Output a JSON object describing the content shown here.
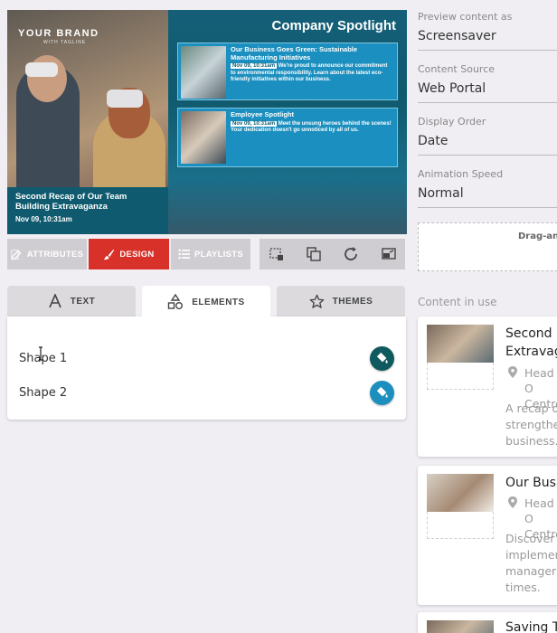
{
  "preview": {
    "brand": "YOUR BRAND",
    "brand_sub": "WITH TAGLINE",
    "feature": {
      "title": "Second Recap of Our Team Building Extravaganza",
      "date": "Nov 09, 10:31am"
    },
    "spotlight_title": "Company Spotlight",
    "cards": [
      {
        "title": "Our Business Goes Green: Sustainable Manufacturing Initiatives",
        "date": "Nov 09, 10:31am",
        "body": " We're proud to announce our commitment to environmental responsibility. Learn about the latest eco-friendly initiatives within our business."
      },
      {
        "title": "Employee Spotlight",
        "date": "Nov 09, 10:31am",
        "body": " Meet the unsung heroes behind the scenes! Your dedication doesn't go unnoticed by all of us."
      }
    ]
  },
  "toolbar": {
    "attributes": "ATTRIBUTES",
    "design": "DESIGN",
    "playlists": "PLAYLISTS",
    "icons": [
      "crop-icon",
      "copy-icon",
      "refresh-icon",
      "screen-swap-icon"
    ]
  },
  "tabs": {
    "text": "TEXT",
    "elements": "ELEMENTS",
    "themes": "THEMES"
  },
  "elements": [
    {
      "label": "Shape 1",
      "color": "#0f5a5e"
    },
    {
      "label": "Shape 2",
      "color": "#1d8fbe"
    }
  ],
  "settings": [
    {
      "label": "Preview content as",
      "value": "Screensaver"
    },
    {
      "label": "Content Source",
      "value": "Web Portal"
    },
    {
      "label": "Display Order",
      "value": "Date"
    },
    {
      "label": "Animation Speed",
      "value": "Normal"
    }
  ],
  "dropzone_text": "Drag-an",
  "content_in_use_label": "Content in use",
  "content_items": [
    {
      "title": "Second R\nExtravag",
      "location": "Head O\nCentre",
      "description": "A recap of\nstrengthe\nbusiness."
    },
    {
      "title": "Our Busi",
      "location": "Head O\nCentre",
      "description": "Discover h\nimplemen\nmanager,\ntimes."
    },
    {
      "title": "Saving T"
    }
  ],
  "colors": {
    "accent_red": "#d8312a",
    "teal": "#0f5a6e",
    "card_blue": "#1b8fbf"
  }
}
